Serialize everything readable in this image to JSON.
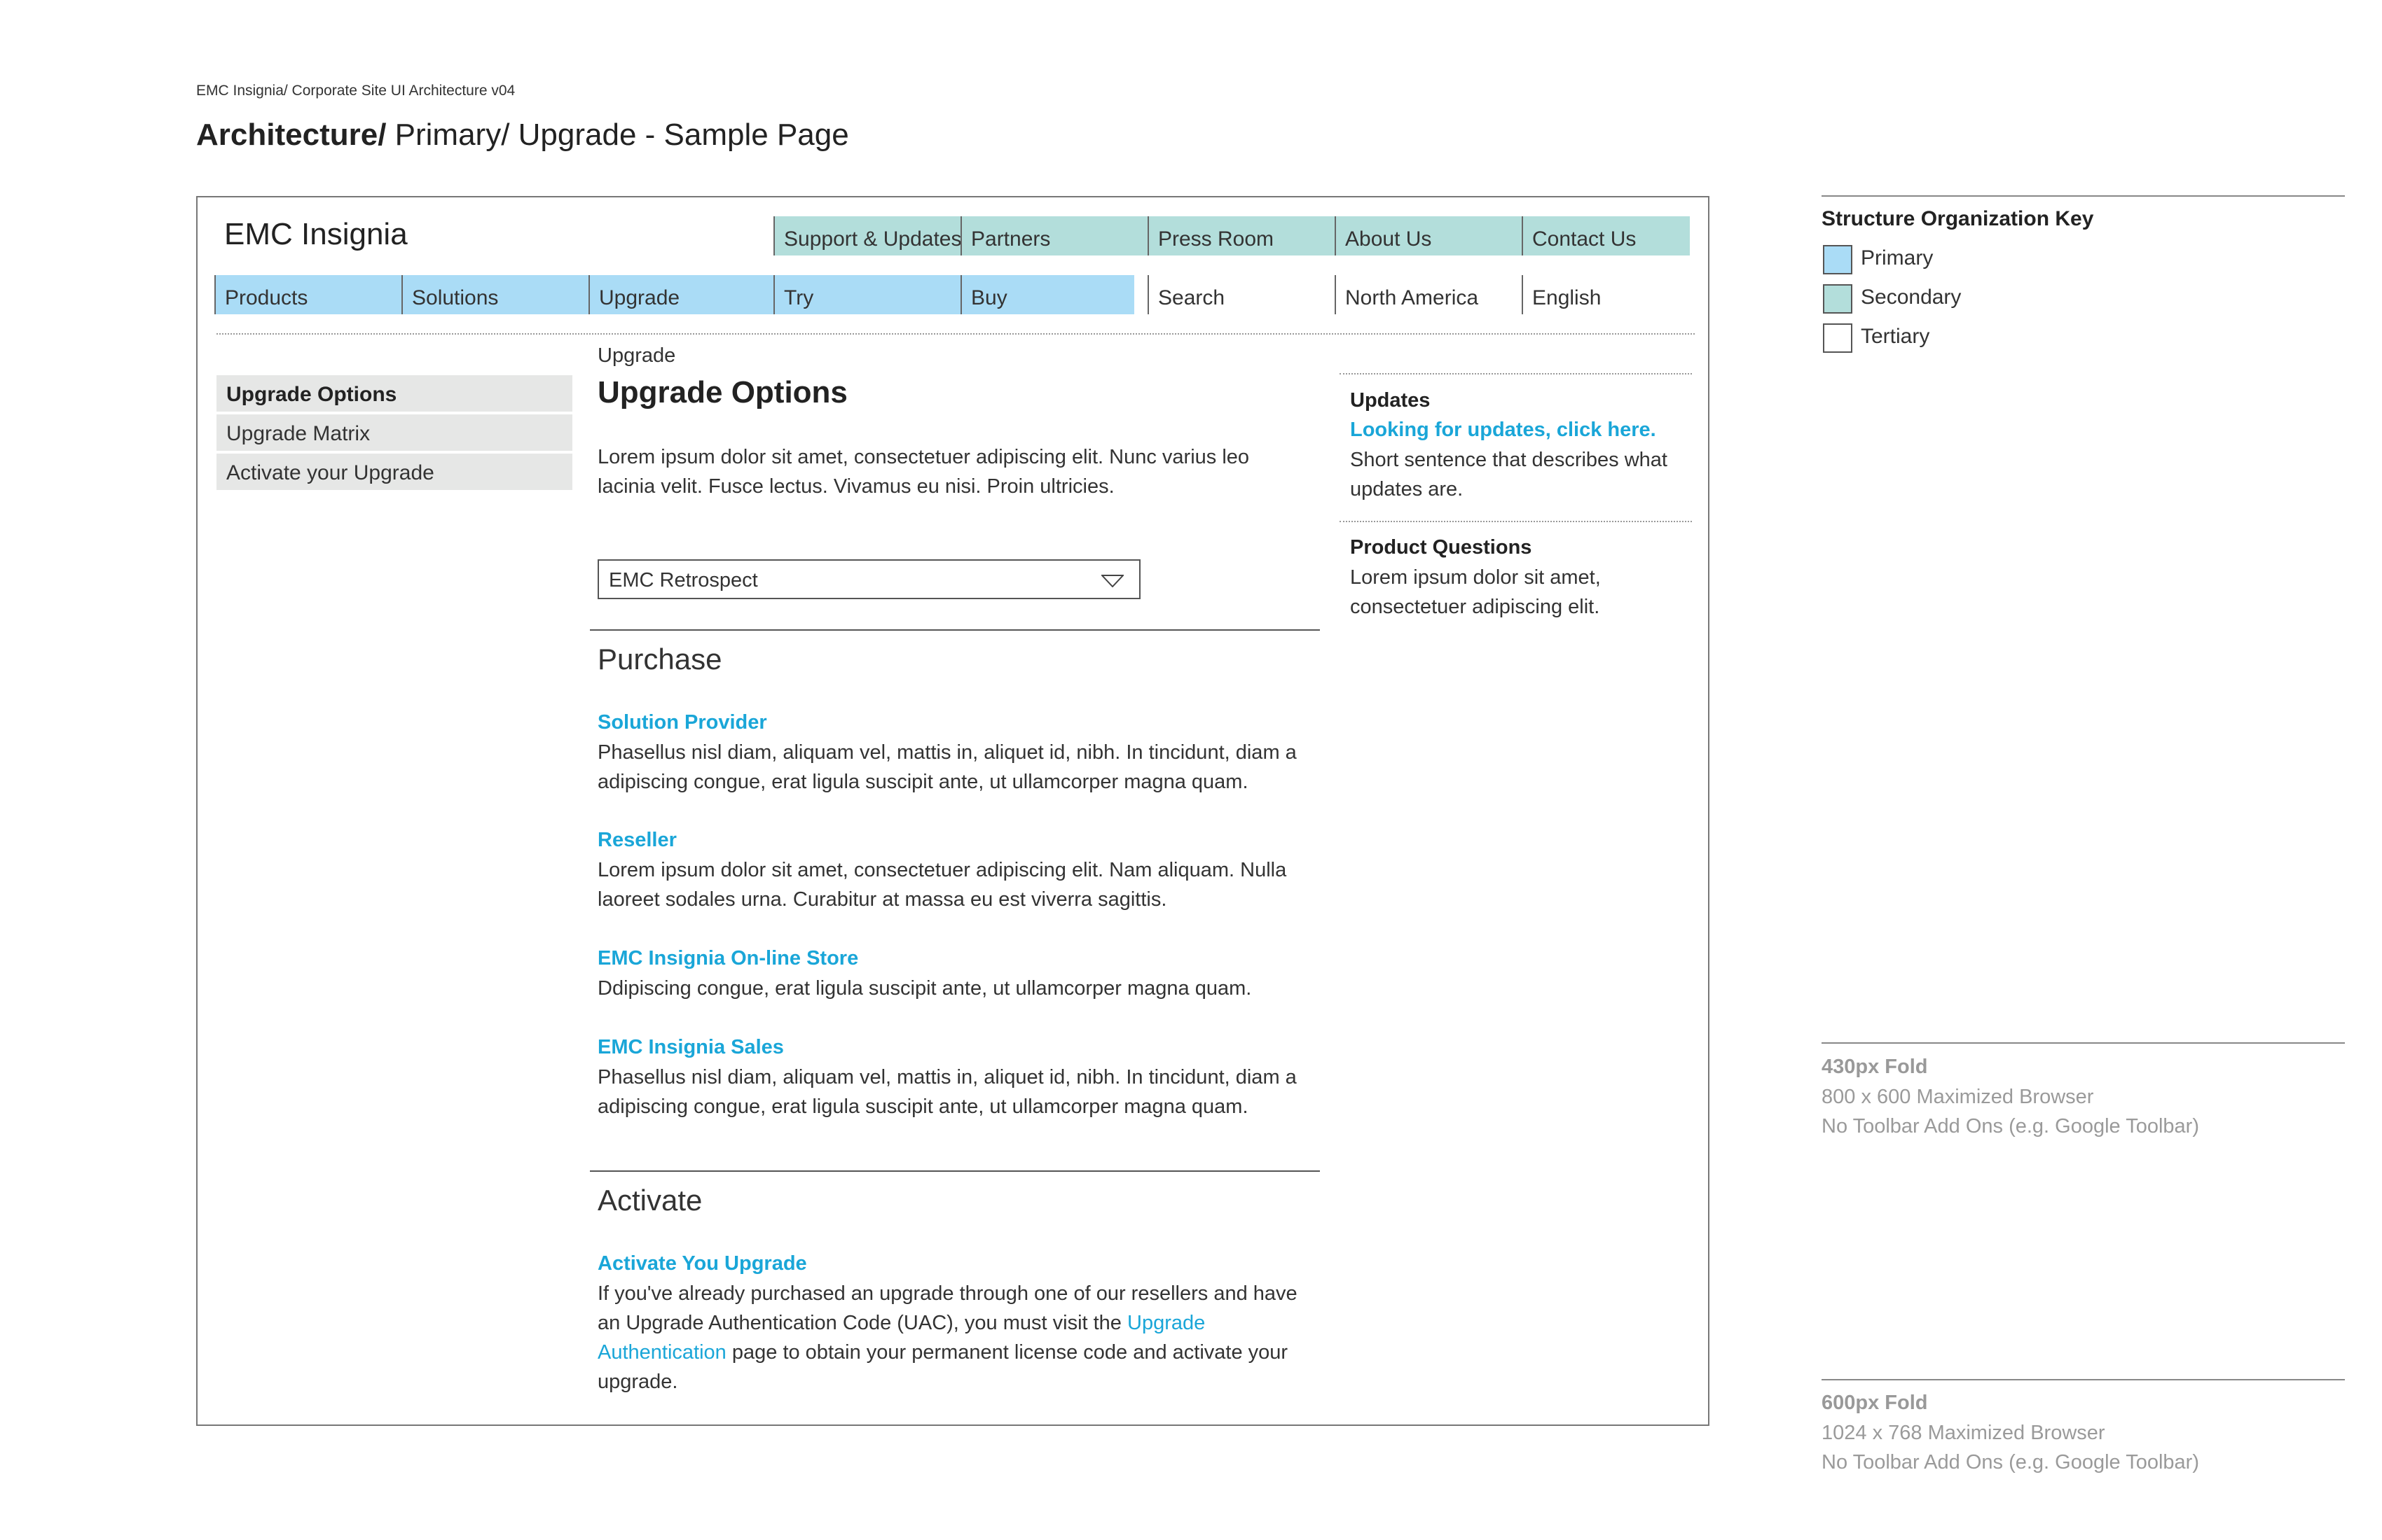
{
  "doc": {
    "label": "EMC Insignia/ Corporate Site UI Architecture v04",
    "heading_bold": "Architecture/",
    "heading_rest": " Primary/ Upgrade - Sample Page"
  },
  "site": {
    "title": "EMC Insignia",
    "top_nav": [
      "Support & Updates",
      "Partners",
      "Press Room",
      "About Us",
      "Contact Us"
    ],
    "primary_nav": [
      "Products",
      "Solutions",
      "Upgrade",
      "Try",
      "Buy"
    ],
    "tertiary_nav": [
      "Search",
      "North America",
      "English"
    ]
  },
  "sidebar": {
    "items": [
      {
        "label": "Upgrade Options"
      },
      {
        "label": "Upgrade Matrix"
      },
      {
        "label": "Activate your Upgrade"
      }
    ]
  },
  "main": {
    "breadcrumb": "Upgrade",
    "title": "Upgrade Options",
    "intro_line1": "Lorem ipsum dolor sit amet, consectetuer adipiscing elit. Nunc varius leo",
    "intro_line2": "lacinia velit. Fusce lectus. Vivamus eu nisi. Proin ultricies.",
    "product_select": "EMC Retrospect",
    "purchase": {
      "title": "Purchase",
      "items": [
        {
          "title": "Solution Provider",
          "line1": "Phasellus nisl diam, aliquam vel, mattis in, aliquet id, nibh. In tincidunt, diam a",
          "line2": "adipiscing congue, erat ligula suscipit ante, ut ullamcorper magna quam."
        },
        {
          "title": "Reseller",
          "line1": "Lorem ipsum dolor sit amet, consectetuer adipiscing elit. Nam aliquam. Nulla",
          "line2": "laoreet sodales urna. Curabitur at massa eu est viverra sagittis."
        },
        {
          "title": "EMC Insignia On-line Store",
          "line1": "Ddipiscing congue, erat ligula suscipit ante, ut ullamcorper magna quam."
        },
        {
          "title": "EMC Insignia Sales",
          "line1": "Phasellus nisl diam, aliquam vel, mattis in, aliquet id, nibh. In tincidunt, diam a",
          "line2": "adipiscing congue, erat ligula suscipit ante, ut ullamcorper magna quam."
        }
      ]
    },
    "activate": {
      "title": "Activate",
      "item_title": "Activate You Upgrade",
      "line1": "If you've already purchased an upgrade through one of our resellers and have",
      "line2_pre": "an Upgrade Authentication Code (UAC), you must visit the ",
      "link_part1": "Upgrade",
      "link_part2": "Authentication",
      "line3_post": " page to obtain your permanent license code and activate your",
      "line4": "upgrade."
    }
  },
  "rail": {
    "updates_title": "Updates",
    "updates_link": "Looking for updates, click here.",
    "updates_line1": "Short sentence that describes what",
    "updates_line2": "updates are.",
    "questions_title": "Product Questions",
    "questions_line1": "Lorem ipsum dolor sit amet,",
    "questions_line2": "consectetuer adipiscing elit."
  },
  "key": {
    "title": "Structure Organization Key",
    "items": [
      {
        "label": "Primary",
        "color": "#aadcf6"
      },
      {
        "label": "Secondary",
        "color": "#b3dedb"
      },
      {
        "label": "Tertiary",
        "color": "#ffffff"
      }
    ]
  },
  "folds": [
    {
      "title": "430px Fold",
      "line1": "800 x 600 Maximized Browser",
      "line2": "No Toolbar Add Ons (e.g. Google Toolbar)"
    },
    {
      "title": "600px Fold",
      "line1": "1024 x 768 Maximized Browser",
      "line2": "No Toolbar Add Ons (e.g. Google Toolbar)"
    }
  ],
  "colors": {
    "primary": "#aadcf6",
    "secondary": "#b3dedb",
    "link": "#1aa6d8"
  }
}
